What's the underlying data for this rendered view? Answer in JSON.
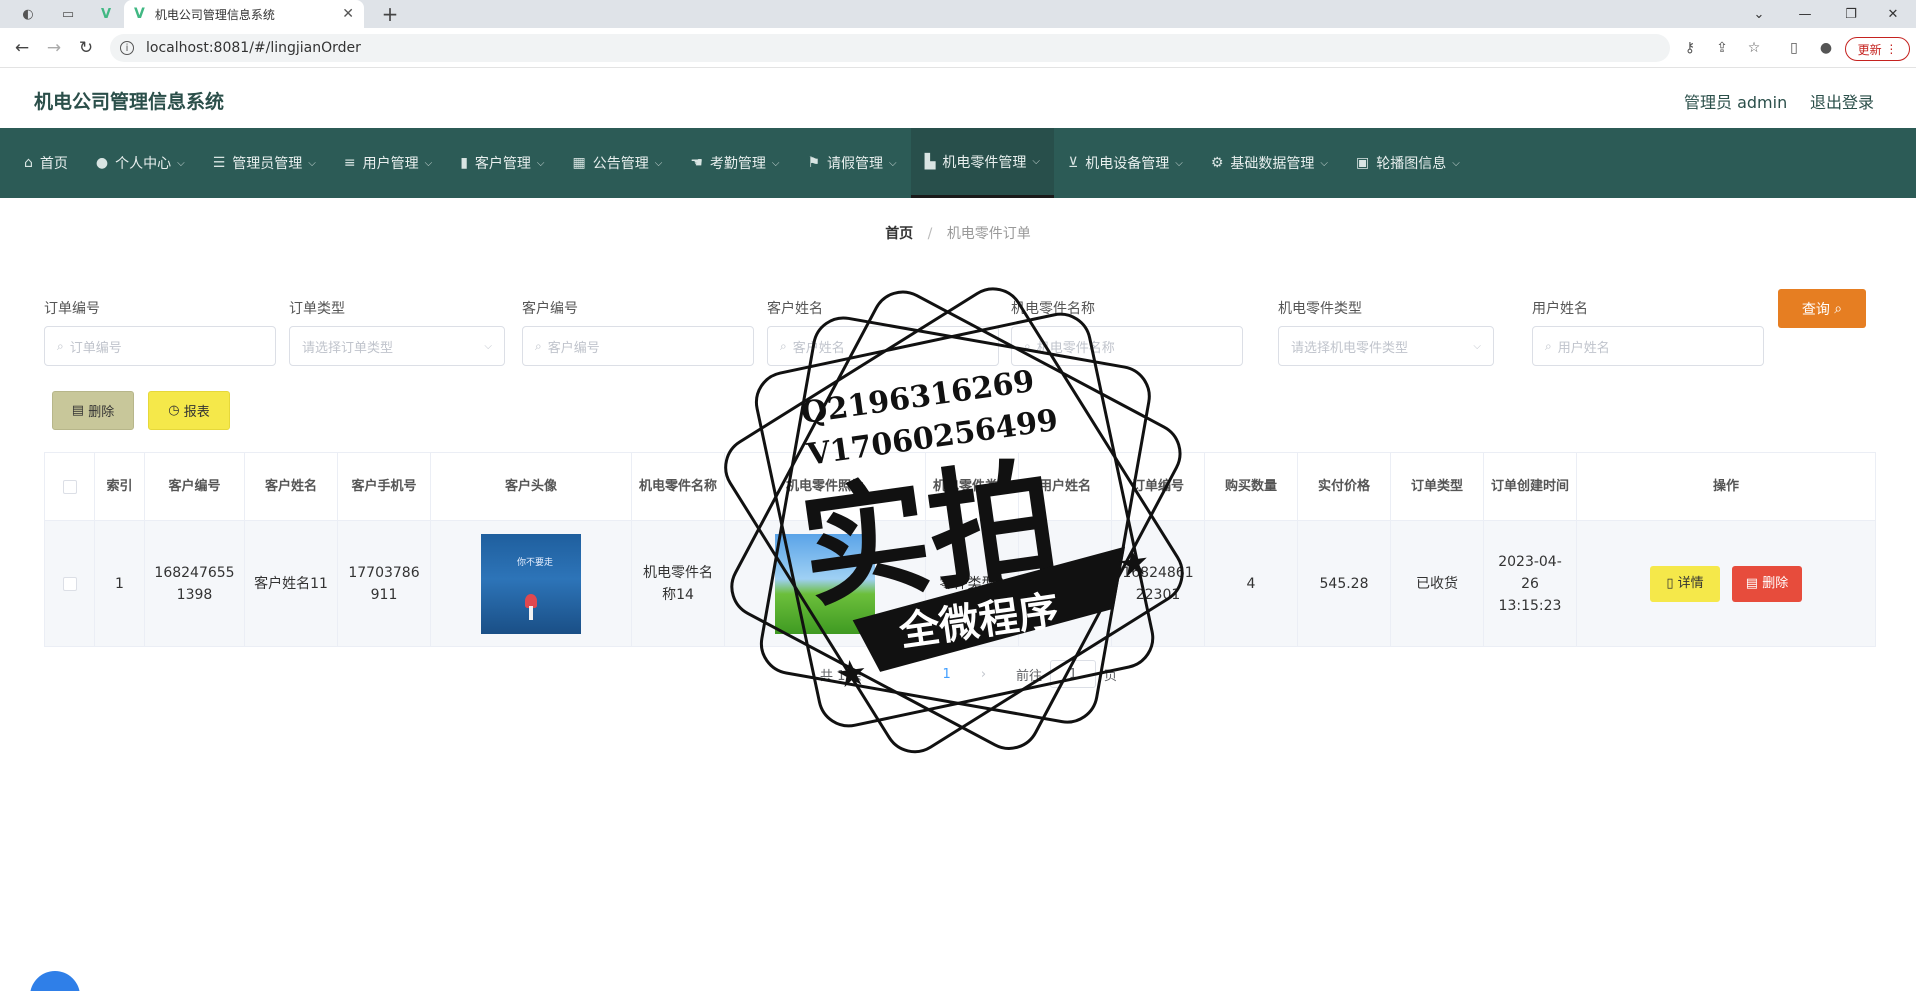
{
  "browser": {
    "tab_title": "机电公司管理信息系统",
    "url": "localhost:8081/#/lingjianOrder",
    "update_label": "更新"
  },
  "header": {
    "title": "机电公司管理信息系统",
    "admin": "管理员 admin",
    "logout": "退出登录"
  },
  "nav": [
    {
      "label": "首页",
      "icon": "home-icon"
    },
    {
      "label": "个人中心",
      "icon": "user-icon"
    },
    {
      "label": "管理员管理",
      "icon": "sliders-icon"
    },
    {
      "label": "用户管理",
      "icon": "list-icon"
    },
    {
      "label": "客户管理",
      "icon": "bar-chart-icon"
    },
    {
      "label": "公告管理",
      "icon": "grid-icon"
    },
    {
      "label": "考勤管理",
      "icon": "hand-icon"
    },
    {
      "label": "请假管理",
      "icon": "flag-icon"
    },
    {
      "label": "机电零件管理",
      "icon": "building-icon"
    },
    {
      "label": "机电设备管理",
      "icon": "mic-icon"
    },
    {
      "label": "基础数据管理",
      "icon": "gear-icon"
    },
    {
      "label": "轮播图信息",
      "icon": "picture-icon"
    }
  ],
  "breadcrumb": {
    "home": "首页",
    "current": "机电零件订单"
  },
  "search": {
    "order_no": {
      "label": "订单编号",
      "placeholder": "订单编号"
    },
    "order_type": {
      "label": "订单类型",
      "placeholder": "请选择订单类型"
    },
    "customer_no": {
      "label": "客户编号",
      "placeholder": "客户编号"
    },
    "customer_name": {
      "label": "客户姓名",
      "placeholder": "客户姓名"
    },
    "part_name": {
      "label": "机电零件名称",
      "placeholder": "机电零件名称"
    },
    "part_type": {
      "label": "机电零件类型",
      "placeholder": "请选择机电零件类型"
    },
    "user_name": {
      "label": "用户姓名",
      "placeholder": "用户姓名"
    },
    "query_label": "查询"
  },
  "actions": {
    "delete_label": "删除",
    "report_label": "报表"
  },
  "table": {
    "columns": [
      "索引",
      "客户编号",
      "客户姓名",
      "客户手机号",
      "客户头像",
      "机电零件名称",
      "机电零件照片",
      "机电零件类型",
      "用户姓名",
      "订单编号",
      "购买数量",
      "实付价格",
      "订单类型",
      "订单创建时间",
      "操作"
    ],
    "rows": [
      {
        "index": "1",
        "customer_no": "1682476551398",
        "customer_name": "客户姓名11",
        "phone": "17703786911",
        "part_name": "机电零件名称14",
        "part_type": "零件类型3",
        "user_name": "用户",
        "order_no": "1682486122301",
        "quantity": "4",
        "price": "545.28",
        "order_type": "已收货",
        "created_at": "2023-04-26 13:15:23",
        "detail_label": "详情",
        "delete_label": "删除",
        "avatar_caption": "你不要走"
      }
    ]
  },
  "pagination": {
    "total": "共 1 条",
    "page": "1",
    "goto": "前往",
    "page_input": "1",
    "page_suffix": "页"
  },
  "watermark": {
    "line1": "Q2196316269",
    "line2": "V17060256499",
    "big": "实拍",
    "banner": "全微程序"
  },
  "colors": {
    "nav_bg": "#2c5b56",
    "query": "#e67e22",
    "delete": "#e74c3c",
    "detail": "#f5e84a"
  }
}
